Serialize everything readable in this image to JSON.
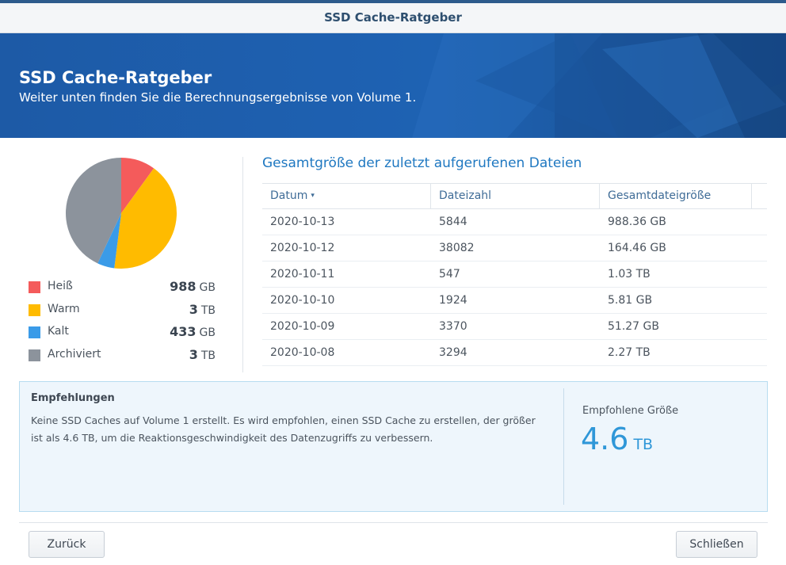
{
  "window": {
    "title": "SSD Cache-Ratgeber"
  },
  "banner": {
    "title": "SSD Cache-Ratgeber",
    "subtitle": "Weiter unten finden Sie die Berechnungsergebnisse von Volume 1."
  },
  "chart_data": {
    "type": "pie",
    "title": "",
    "slices": [
      {
        "name": "Heiß",
        "value": 988,
        "unit": "GB",
        "color": "#f45b5b"
      },
      {
        "name": "Warm",
        "value": 3,
        "unit": "TB",
        "color": "#ffbb00"
      },
      {
        "name": "Kalt",
        "value": 433,
        "unit": "GB",
        "color": "#3a9be8"
      },
      {
        "name": "Archiviert",
        "value": 3,
        "unit": "TB",
        "color": "#8c939c"
      }
    ],
    "slice_shares": [
      0.1,
      0.42,
      0.05,
      0.43
    ]
  },
  "table": {
    "title": "Gesamtgröße der zuletzt aufgerufenen Dateien",
    "sort_indicator": "▾",
    "columns": [
      "Datum",
      "Dateizahl",
      "Gesamtdateigröße"
    ],
    "rows": [
      [
        "2020-10-13",
        "5844",
        "988.36 GB"
      ],
      [
        "2020-10-12",
        "38082",
        "164.46 GB"
      ],
      [
        "2020-10-11",
        "547",
        "1.03 TB"
      ],
      [
        "2020-10-10",
        "1924",
        "5.81 GB"
      ],
      [
        "2020-10-09",
        "3370",
        "51.27 GB"
      ],
      [
        "2020-10-08",
        "3294",
        "2.27 TB"
      ]
    ]
  },
  "recommendation": {
    "title": "Empfehlungen",
    "text": "Keine SSD Caches auf Volume 1 erstellt. Es wird empfohlen, einen SSD Cache zu erstellen, der größer ist als 4.6 TB, um die Reaktionsgeschwindigkeit des Datenzugriffs zu verbessern.",
    "size_label": "Empfohlene Größe",
    "size_value": "4.6",
    "size_unit": "TB"
  },
  "buttons": {
    "back": "Zurück",
    "close": "Schließen"
  },
  "colors": {
    "accent": "#1f78c1",
    "banner": "#1e62b3"
  }
}
